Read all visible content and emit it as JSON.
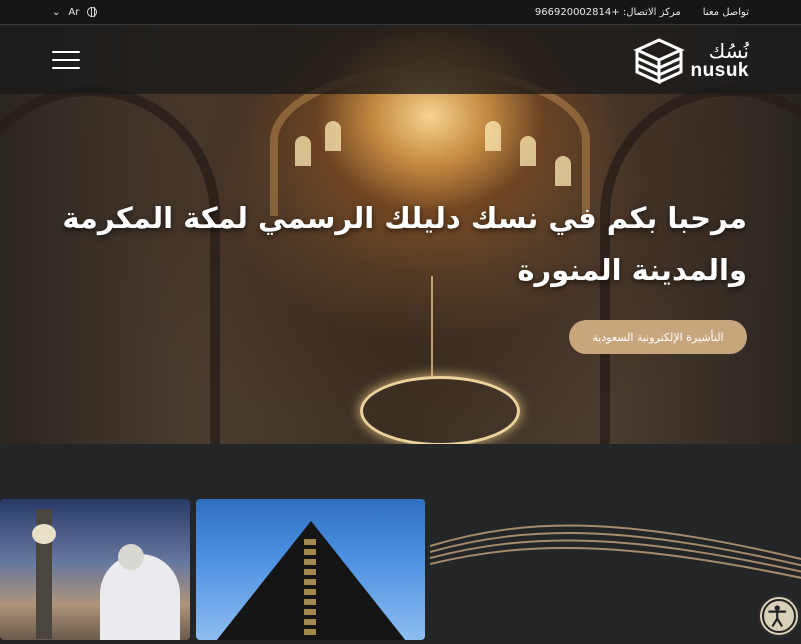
{
  "topbar": {
    "lang_label": "Ar",
    "contact_us": "تواصل معنا",
    "call_center_label": "مركز الاتصال:",
    "call_center_number": "+966920002814"
  },
  "brand": {
    "logo_ar": "نُسُك",
    "logo_en": "nusuk"
  },
  "hero": {
    "title": "مرحبا بكم في نسك دليلك الرسمي لمكة المكرمة والمدينة المنورة",
    "cta_label": "التأشيرة الإلكترونية السعودية"
  },
  "icons": {
    "menu": "hamburger-menu-icon",
    "globe": "globe-icon",
    "chevron": "chevron-down-icon",
    "accessibility": "accessibility-icon"
  },
  "colors": {
    "accent": "#c7a57d",
    "background": "#232527",
    "topbar": "#151618"
  }
}
